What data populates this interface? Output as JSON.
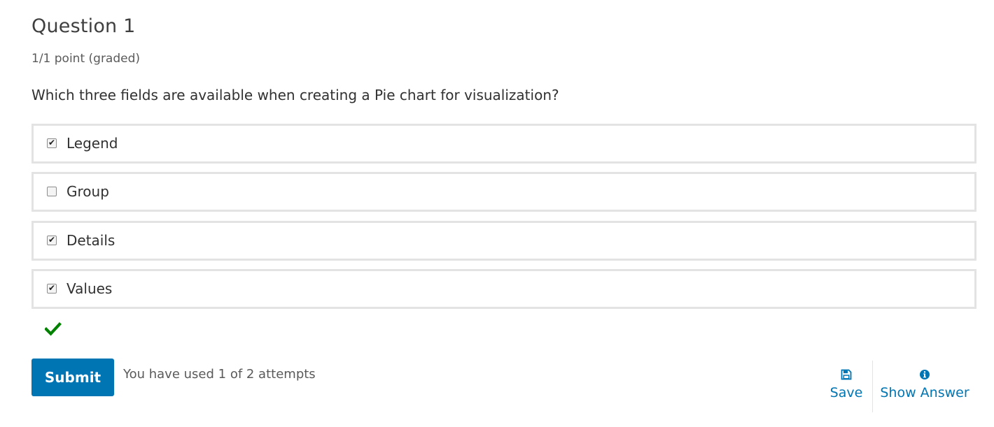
{
  "question": {
    "title": "Question 1",
    "points": "1/1 point (graded)",
    "prompt": "Which three fields are available when creating a Pie chart for visualization?"
  },
  "choices": [
    {
      "label": "Legend",
      "checked": true
    },
    {
      "label": "Group",
      "checked": false
    },
    {
      "label": "Details",
      "checked": true
    },
    {
      "label": "Values",
      "checked": true
    }
  ],
  "status": {
    "icon": "checkmark-icon",
    "color": "#008100",
    "correct": true
  },
  "actions": {
    "submit_label": "Submit",
    "attempts_text": "You have used 1 of 2 attempts",
    "save_label": "Save",
    "save_icon": "floppy-disk-icon",
    "show_answer_label": "Show Answer",
    "show_answer_icon": "info-circle-icon"
  },
  "colors": {
    "accent": "#0075b4",
    "border": "#e3e3e3",
    "correct": "#008100"
  }
}
